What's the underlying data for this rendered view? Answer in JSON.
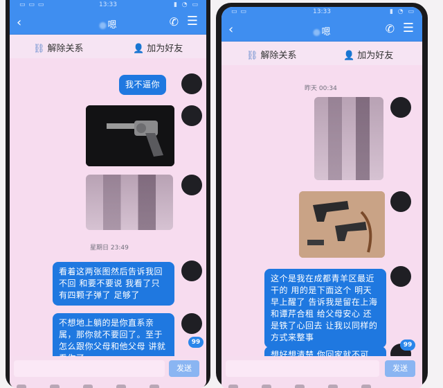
{
  "left": {
    "status_time": "13:33",
    "status_icons": "▮ ◔ ▭",
    "status_left": "▭ ▭ ▭",
    "title": "嗯",
    "unlink_label": "解除关系",
    "add_friend_label": "加为好友",
    "msg1": "我不逼你",
    "timestamp": "星期日 23:49",
    "msg2": "看着这两张图然后告诉我回不回 和要不要说 我看了只有四颗子弹了 足够了",
    "msg3": "不想地上躺的是你直系亲属，那你就不要回了。至于怎么跟你父母和他父母 讲就看你了",
    "badge": "99",
    "send_label": "发送"
  },
  "right": {
    "status_time": "13:33",
    "status_icons": "▮ ◔ ▭",
    "status_left": "▭ ▭",
    "title": "嗯",
    "unlink_label": "解除关系",
    "add_friend_label": "加为好友",
    "timestamp": "昨天 00:34",
    "msg1": "这个是我在成都青羊区最近干的 用的是下面这个 明天早上醒了 告诉我是留在上海和谭芹合租 给父母安心 还是铁了心回去 让我以同样的方式来整事",
    "msg2": "想好想清楚 你回家就不可",
    "badge": "99",
    "send_label": "发送"
  },
  "icons": {
    "back": "‹",
    "phone": "✆",
    "menu": "☰",
    "link": "🔗",
    "person": "👤"
  }
}
